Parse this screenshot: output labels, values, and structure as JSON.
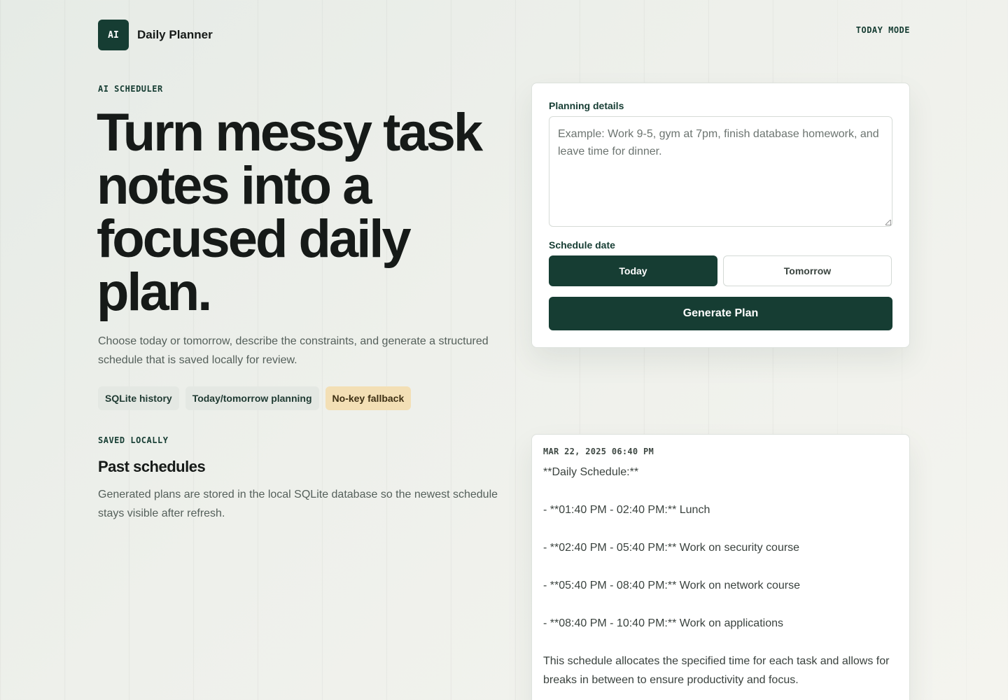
{
  "brand": {
    "logo_text": "AI",
    "name": "Daily Planner"
  },
  "header": {
    "mode_label": "TODAY MODE"
  },
  "hero": {
    "eyebrow": "AI SCHEDULER",
    "headline": "Turn messy task notes into a focused daily plan.",
    "subtitle": "Choose today or tomorrow, describe the constraints, and generate a structured schedule that is saved locally for review.",
    "chips": [
      "SQLite history",
      "Today/tomorrow planning",
      "No-key fallback"
    ]
  },
  "past": {
    "eyebrow": "SAVED LOCALLY",
    "title": "Past schedules",
    "description": "Generated plans are stored in the local SQLite database so the newest schedule stays visible after refresh."
  },
  "form": {
    "details_label": "Planning details",
    "details_value": "",
    "details_placeholder": "Example: Work 9-5, gym at 7pm, finish database homework, and leave time for dinner.",
    "date_label": "Schedule date",
    "date_options": [
      "Today",
      "Tomorrow"
    ],
    "selected_date": "Today",
    "generate_label": "Generate Plan"
  },
  "schedule": {
    "timestamp": "MAR 22, 2025 06:40 PM",
    "lines": [
      "**Daily Schedule:**",
      "- **01:40 PM - 02:40 PM:** Lunch",
      "- **02:40 PM - 05:40 PM:** Work on security course",
      "- **05:40 PM - 08:40 PM:** Work on network course",
      "- **08:40 PM - 10:40 PM:** Work on applications",
      "This schedule allocates the specified time for each task and allows for breaks in between to ensure productivity and focus."
    ]
  },
  "colors": {
    "accent": "#163d33",
    "chip": "#e4e8e3",
    "chip_warm": "#f3dfb5"
  }
}
